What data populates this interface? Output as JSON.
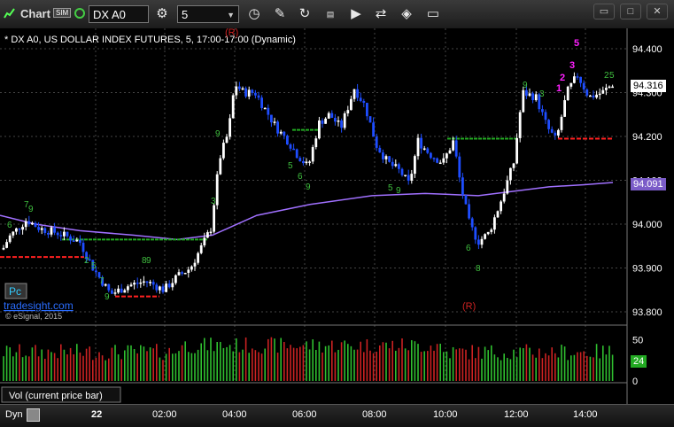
{
  "toolbar": {
    "app_title": "Chart",
    "sim_badge": "SIM",
    "symbol": "DX A0",
    "interval": "5"
  },
  "chart": {
    "title": "* DX A0, US DOLLAR INDEX FUTURES, 5, 17:00-17:00 (Dynamic)",
    "logo_text": "Pc",
    "site_text": "tradesight.com",
    "copyright": "© eSignal, 2015",
    "r_marker_top": "(R)",
    "r_marker_bottom": "(R)",
    "price_axis": [
      "94.400",
      "94.300",
      "94.200",
      "94.100",
      "94.000",
      "93.900",
      "93.800"
    ],
    "current_price": "94.316",
    "ma_price": "94.091",
    "time_axis": [
      "22",
      "02:00",
      "04:00",
      "06:00",
      "08:00",
      "10:00",
      "12:00",
      "14:00"
    ],
    "day_label": "Dyn",
    "colors": {
      "up": "#ffffff",
      "down": "#1e4dff",
      "ma": "#a070ff",
      "support": "#ff2020",
      "resistance": "#22aa22",
      "count": "#3fbf3f",
      "signal": "#ff20ff"
    }
  },
  "volume": {
    "label": "Vol (current price bar)",
    "axis": [
      "50",
      "25",
      "0"
    ],
    "current": "24"
  },
  "chart_data": {
    "type": "candlestick",
    "price_axis_range": [
      93.78,
      94.46
    ],
    "volume_axis_range": [
      0,
      60
    ],
    "moving_average_last": 94.091,
    "last_price": 94.316,
    "support_levels": [
      93.925,
      93.835,
      94.195
    ],
    "resistance_levels": [
      93.965,
      94.215,
      94.195
    ],
    "setup_numbers": [
      "1",
      "2",
      "3",
      "5"
    ]
  }
}
